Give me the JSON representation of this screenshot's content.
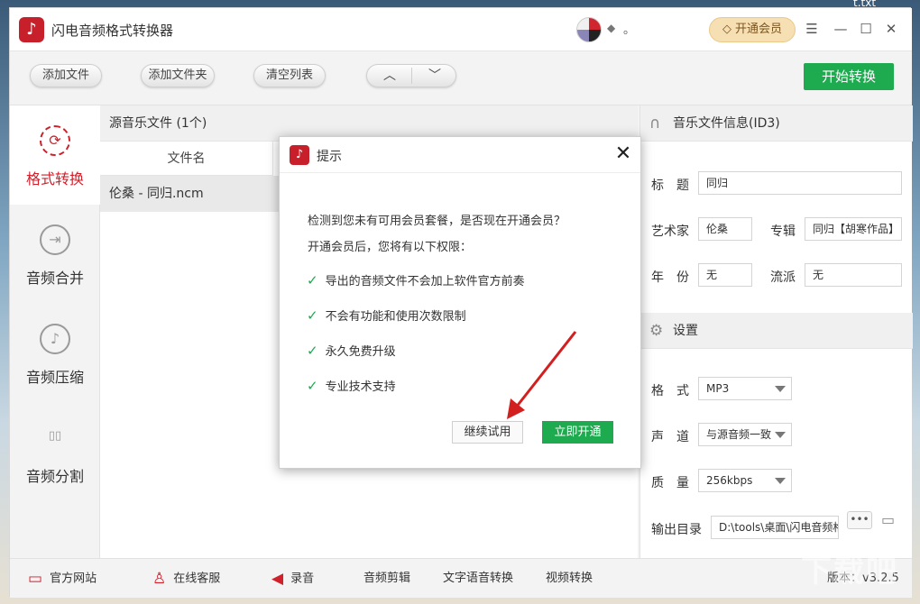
{
  "desktop": {
    "corner_text": "t.txt"
  },
  "app": {
    "title": "闪电音频格式转换器",
    "user_dot": "。",
    "vip_button": "开通会员"
  },
  "window_controls": {
    "menu": "☰",
    "minimize": "—",
    "maximize": "☐",
    "close": "✕"
  },
  "toolbar": {
    "add_file": "添加文件",
    "add_folder": "添加文件夹",
    "clear_list": "清空列表",
    "move_up": "︿",
    "move_down": "﹀",
    "start": "开始转换"
  },
  "sidebar": {
    "items": [
      {
        "label": "格式转换",
        "icon": "refresh-icon",
        "glyph": "⟳",
        "active": true
      },
      {
        "label": "音频合并",
        "icon": "merge-icon",
        "glyph": "⇥",
        "active": false
      },
      {
        "label": "音频压缩",
        "icon": "music-note-icon",
        "glyph": "♪",
        "active": false
      },
      {
        "label": "音频分割",
        "icon": "split-icon",
        "glyph": "▯▯",
        "active": false
      }
    ]
  },
  "file_panel": {
    "header": "源音乐文件 (1个)",
    "column_filename": "文件名",
    "files": [
      "伦桑 - 同归.ncm"
    ]
  },
  "id3": {
    "section_title": "音乐文件信息(ID3)",
    "title_label": "标　题",
    "title_value": "同归",
    "artist_label": "艺术家",
    "artist_value": "伦桑",
    "album_label": "专辑",
    "album_value": "同归【胡寒作品】",
    "year_label": "年　份",
    "year_value": "无",
    "genre_label": "流派",
    "genre_value": "无"
  },
  "settings": {
    "section_title": "设置",
    "format_label": "格　式",
    "format_value": "MP3",
    "channel_label": "声　道",
    "channel_value": "与源音频一致",
    "quality_label": "质　量",
    "quality_value": "256kbps",
    "output_label": "输出目录",
    "output_value": "D:\\tools\\桌面\\闪电音频格",
    "dots": "•••"
  },
  "footer": {
    "website": "官方网站",
    "support": "在线客服",
    "record": "录音",
    "cut": "音频剪辑",
    "tts": "文字语音转换",
    "video": "视频转换",
    "version": "版本：v3.2.5"
  },
  "dialog": {
    "title": "提示",
    "line1": "检测到您未有可用会员套餐，是否现在开通会员？",
    "line2": "开通会员后，您将有以下权限：",
    "perks": [
      "导出的音频文件不会加上软件官方前奏",
      "不会有功能和使用次数限制",
      "永久免费升级",
      "专业技术支持"
    ],
    "continue_trial": "继续试用",
    "open_now": "立即开通"
  },
  "colors": {
    "accent_red": "#d0202b",
    "accent_green": "#1eaa4f",
    "vip_gold": "#f7dfb4"
  }
}
